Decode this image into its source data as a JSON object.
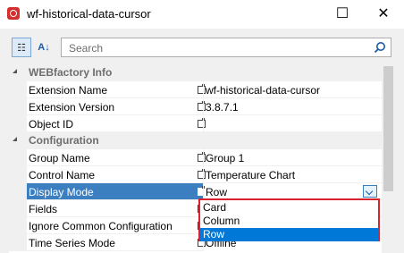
{
  "window": {
    "title": "wf-historical-data-cursor",
    "minimize_glyph": "—",
    "maximize_glyph": "☐",
    "close_glyph": "✕"
  },
  "toolbar": {
    "categorized_glyph": "☷",
    "alphabetical_glyph": "A↓",
    "search_placeholder": "Search",
    "search_value": ""
  },
  "categories": [
    {
      "label": "WEBfactory Info",
      "properties": [
        {
          "name": "Extension Name",
          "value": "wf-historical-data-cursor"
        },
        {
          "name": "Extension Version",
          "value": "3.8.7.1"
        },
        {
          "name": "Object ID",
          "value": ""
        }
      ]
    },
    {
      "label": "Configuration",
      "properties": [
        {
          "name": "Group Name",
          "value": "Group 1"
        },
        {
          "name": "Control Name",
          "value": "Temperature Chart"
        },
        {
          "name": "Display Mode",
          "value": "Row"
        },
        {
          "name": "Fields",
          "value": ""
        },
        {
          "name": "Ignore Common Configuration",
          "value": ""
        },
        {
          "name": "Time Series Mode",
          "value": "Offline"
        }
      ]
    }
  ],
  "dropdown": {
    "options": [
      "Card",
      "Column",
      "Row"
    ],
    "selected": "Row"
  },
  "colors": {
    "selection": "#3c7fc1",
    "highlight_border": "#d9232e",
    "list_selection": "#0078d7"
  }
}
